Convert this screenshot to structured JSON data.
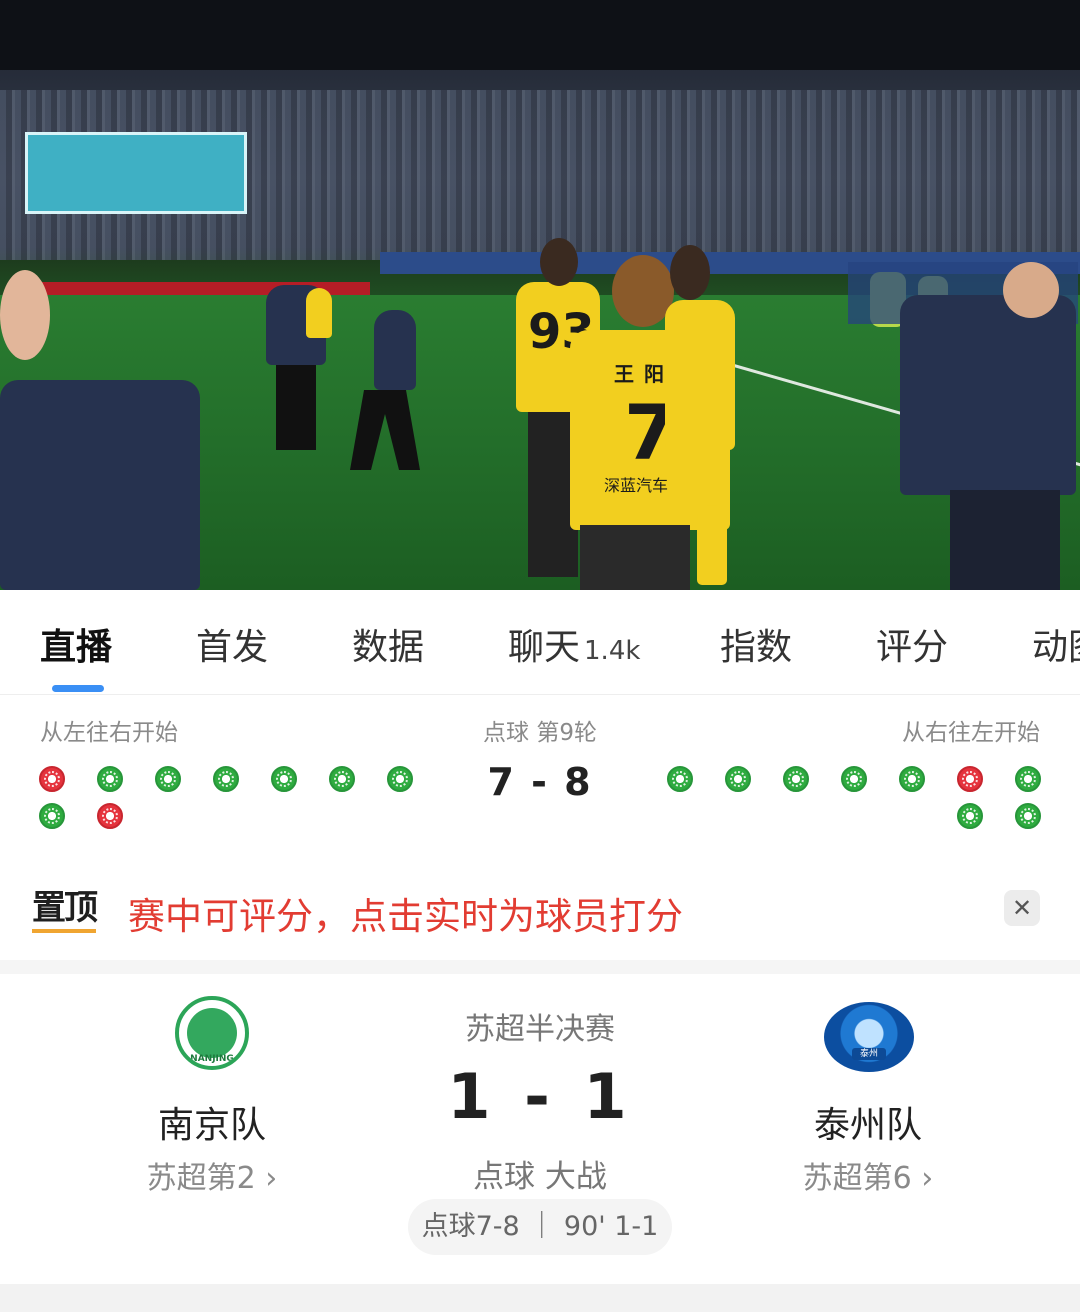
{
  "video": {
    "player_name": "王阳",
    "player_number": "7",
    "player_sponsor": "深蓝汽车",
    "other_number": "93"
  },
  "tabs": [
    {
      "label": "直播",
      "active": true
    },
    {
      "label": "首发"
    },
    {
      "label": "数据"
    },
    {
      "label": "聊天",
      "count": "1.4k"
    },
    {
      "label": "指数"
    },
    {
      "label": "评分"
    },
    {
      "label": "动图"
    }
  ],
  "penalty": {
    "left_label": "从左往右开始",
    "round_label": "点球 第9轮",
    "right_label": "从右往左开始",
    "score": "7 - 8",
    "left_results": [
      "miss",
      "ok",
      "ok",
      "ok",
      "ok",
      "ok",
      "ok",
      "ok",
      "miss"
    ],
    "right_results": [
      "ok",
      "ok",
      "ok",
      "ok",
      "ok",
      "miss",
      "ok",
      "ok",
      "ok"
    ]
  },
  "pinned": {
    "tag": "置顶",
    "text": "赛中可评分，点击实时为球员打分",
    "close_icon": "close-icon"
  },
  "match": {
    "competition": "苏超半决赛",
    "score": "1 - 1",
    "status": "点球 大战",
    "detail": "点球7-8 ｜ 90' 1-1",
    "home": {
      "name": "南京队",
      "rank": "苏超第2",
      "logo_text": "NANJING"
    },
    "away": {
      "name": "泰州队",
      "rank": "苏超第6",
      "logo_text": "泰州"
    }
  },
  "colors": {
    "accent": "#3a8ff5",
    "scored": "#2eab3f",
    "missed": "#e5333d",
    "notice": "#e23c32",
    "jersey": "#f2cf1f"
  }
}
